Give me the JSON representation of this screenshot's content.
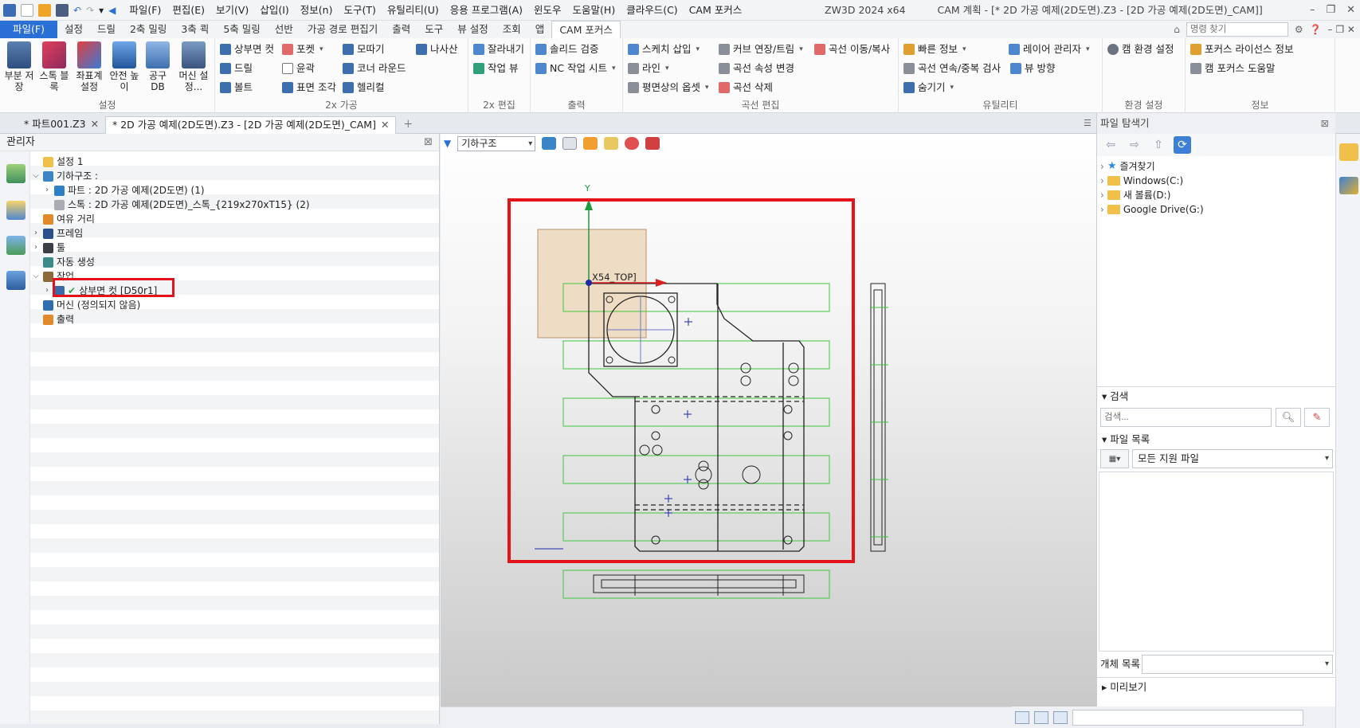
{
  "app": {
    "name": "ZW3D 2024 x64",
    "title": "CAM 계획 - [* 2D 가공 예제(2D도면).Z3 - [2D 가공 예제(2D도면)_CAM]]"
  },
  "menu": [
    "파일(F)",
    "편집(E)",
    "보기(V)",
    "삽입(I)",
    "정보(n)",
    "도구(T)",
    "유틸리티(U)",
    "응용 프로그램(A)",
    "윈도우",
    "도움말(H)",
    "클라우드(C)",
    "CAM 포커스"
  ],
  "window_controls": [
    "–",
    "❐",
    "✕"
  ],
  "command_search": {
    "placeholder": "명령 찾기"
  },
  "ribbon_tabs": {
    "file": "파일(F)",
    "items": [
      "설정",
      "드릴",
      "2축 밀링",
      "3축 쾩",
      "5축 밀링",
      "선반",
      "가공 경로 편집기",
      "출력",
      "도구",
      "뷰 설정",
      "조회",
      "앱"
    ],
    "active": "CAM 포커스"
  },
  "ribbon": {
    "setup": {
      "name": "설정",
      "buttons": [
        "부분 저장",
        "스톡 블록",
        "좌표계 설정",
        "안전 높이",
        "공구 DB",
        "머신 설정..."
      ]
    },
    "milling2x": {
      "name": "2x 가공",
      "col1": [
        "상부면 컷",
        "드릴",
        "볼트"
      ],
      "col2": [
        "포켓",
        "윤곽",
        "표면 조각"
      ],
      "col3": [
        "모따기",
        "코너 라운드",
        "헬리컬"
      ],
      "col4": [
        "나사산"
      ]
    },
    "edit2x": {
      "name": "2x 편집",
      "items": [
        "잘라내기",
        "작업 뷰"
      ]
    },
    "output": {
      "name": "출력",
      "items": [
        "솔리드 검증",
        "NC 작업 시트"
      ]
    },
    "curve_edit": {
      "name": "곡선 편집",
      "items": [
        "스케치 삽입",
        "커브 연장/트림",
        "곡선 이동/복사",
        "라인",
        "곡선 속성 변경",
        "평면상의 옵셋",
        "곡선 삭제"
      ]
    },
    "utility": {
      "name": "유틸리티",
      "items": [
        "빠른 정보",
        "레이어 관리자",
        "곡선 연속/중복 검사",
        "뷰 방향",
        "숨기기"
      ]
    },
    "env": {
      "name": "환경 설정",
      "items": [
        "캠 환경 설정"
      ]
    },
    "info": {
      "name": "정보",
      "items": [
        "포커스 라이선스 정보",
        "캠 포커스 도움말"
      ]
    }
  },
  "doc_tabs": [
    {
      "label": "* 파트001.Z3"
    },
    {
      "label": "* 2D 가공 예제(2D도면).Z3 - [2D 가공 예제(2D도면)_CAM]"
    }
  ],
  "manager": {
    "title": "관리자",
    "tree": [
      {
        "label": "설정 1"
      },
      {
        "label": "기하구조 :"
      },
      {
        "label": "파트 : 2D 가공 예제(2D도면) (1)"
      },
      {
        "label": "스톡 : 2D 가공 예제(2D도면)_스톡_{219x270xT15} (2)"
      },
      {
        "label": "여유 거리"
      },
      {
        "label": "프레임"
      },
      {
        "label": "툴"
      },
      {
        "label": "자동 생성"
      },
      {
        "label": "작업"
      },
      {
        "label": "상부면 컷 [D50r1]"
      },
      {
        "label": "머신 (정의되지 않음)"
      },
      {
        "label": "출력"
      }
    ]
  },
  "viewport": {
    "filter": "기하구조",
    "csys_label": "Y",
    "origin_label": "X54_TOP]",
    "accent": "#e3121b"
  },
  "browser": {
    "title": "파일 탐색기",
    "tree": [
      "즐겨찾기",
      "Windows(C:)",
      "새 볼륨(D:)",
      "Google Drive(G:)"
    ],
    "search_title": "검색",
    "search_placeholder": "검색...",
    "filelist_title": "파일 목록",
    "filetype": "모든 지원 파일",
    "object_list": "개체 목록",
    "preview": "미리보기"
  }
}
